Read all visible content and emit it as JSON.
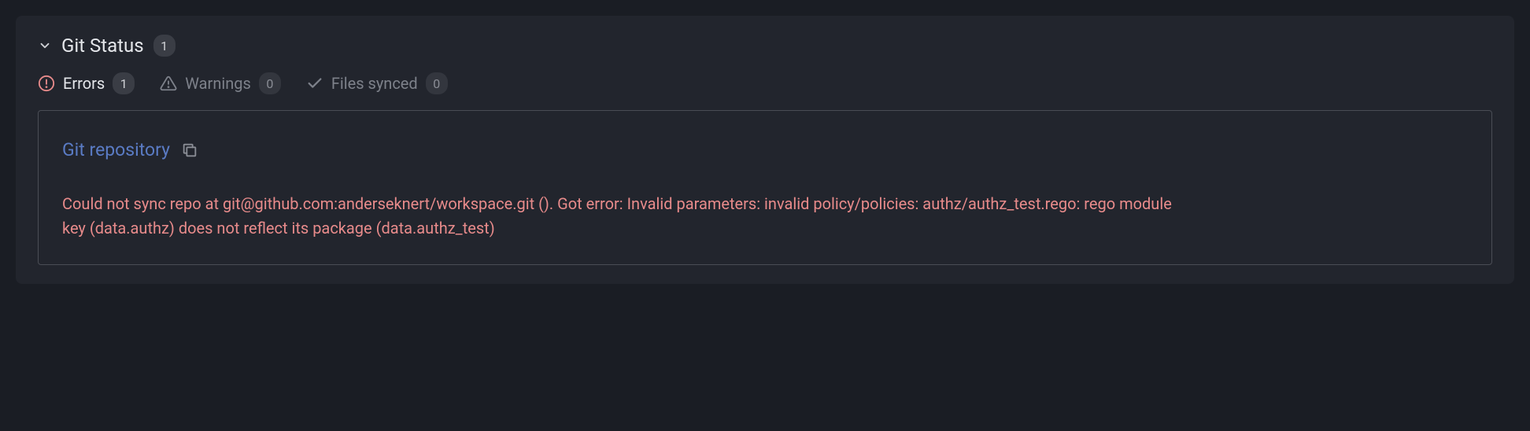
{
  "header": {
    "title": "Git Status",
    "count": "1"
  },
  "tabs": {
    "errors": {
      "label": "Errors",
      "count": "1"
    },
    "warnings": {
      "label": "Warnings",
      "count": "0"
    },
    "files_synced": {
      "label": "Files synced",
      "count": "0"
    }
  },
  "error": {
    "title": "Git repository",
    "message": "Could not sync repo at git@github.com:anderseknert/workspace.git (). Got error: Invalid parameters: invalid policy/policies: authz/authz_test.rego: rego module key (data.authz) does not reflect its package (data.authz_test)"
  }
}
